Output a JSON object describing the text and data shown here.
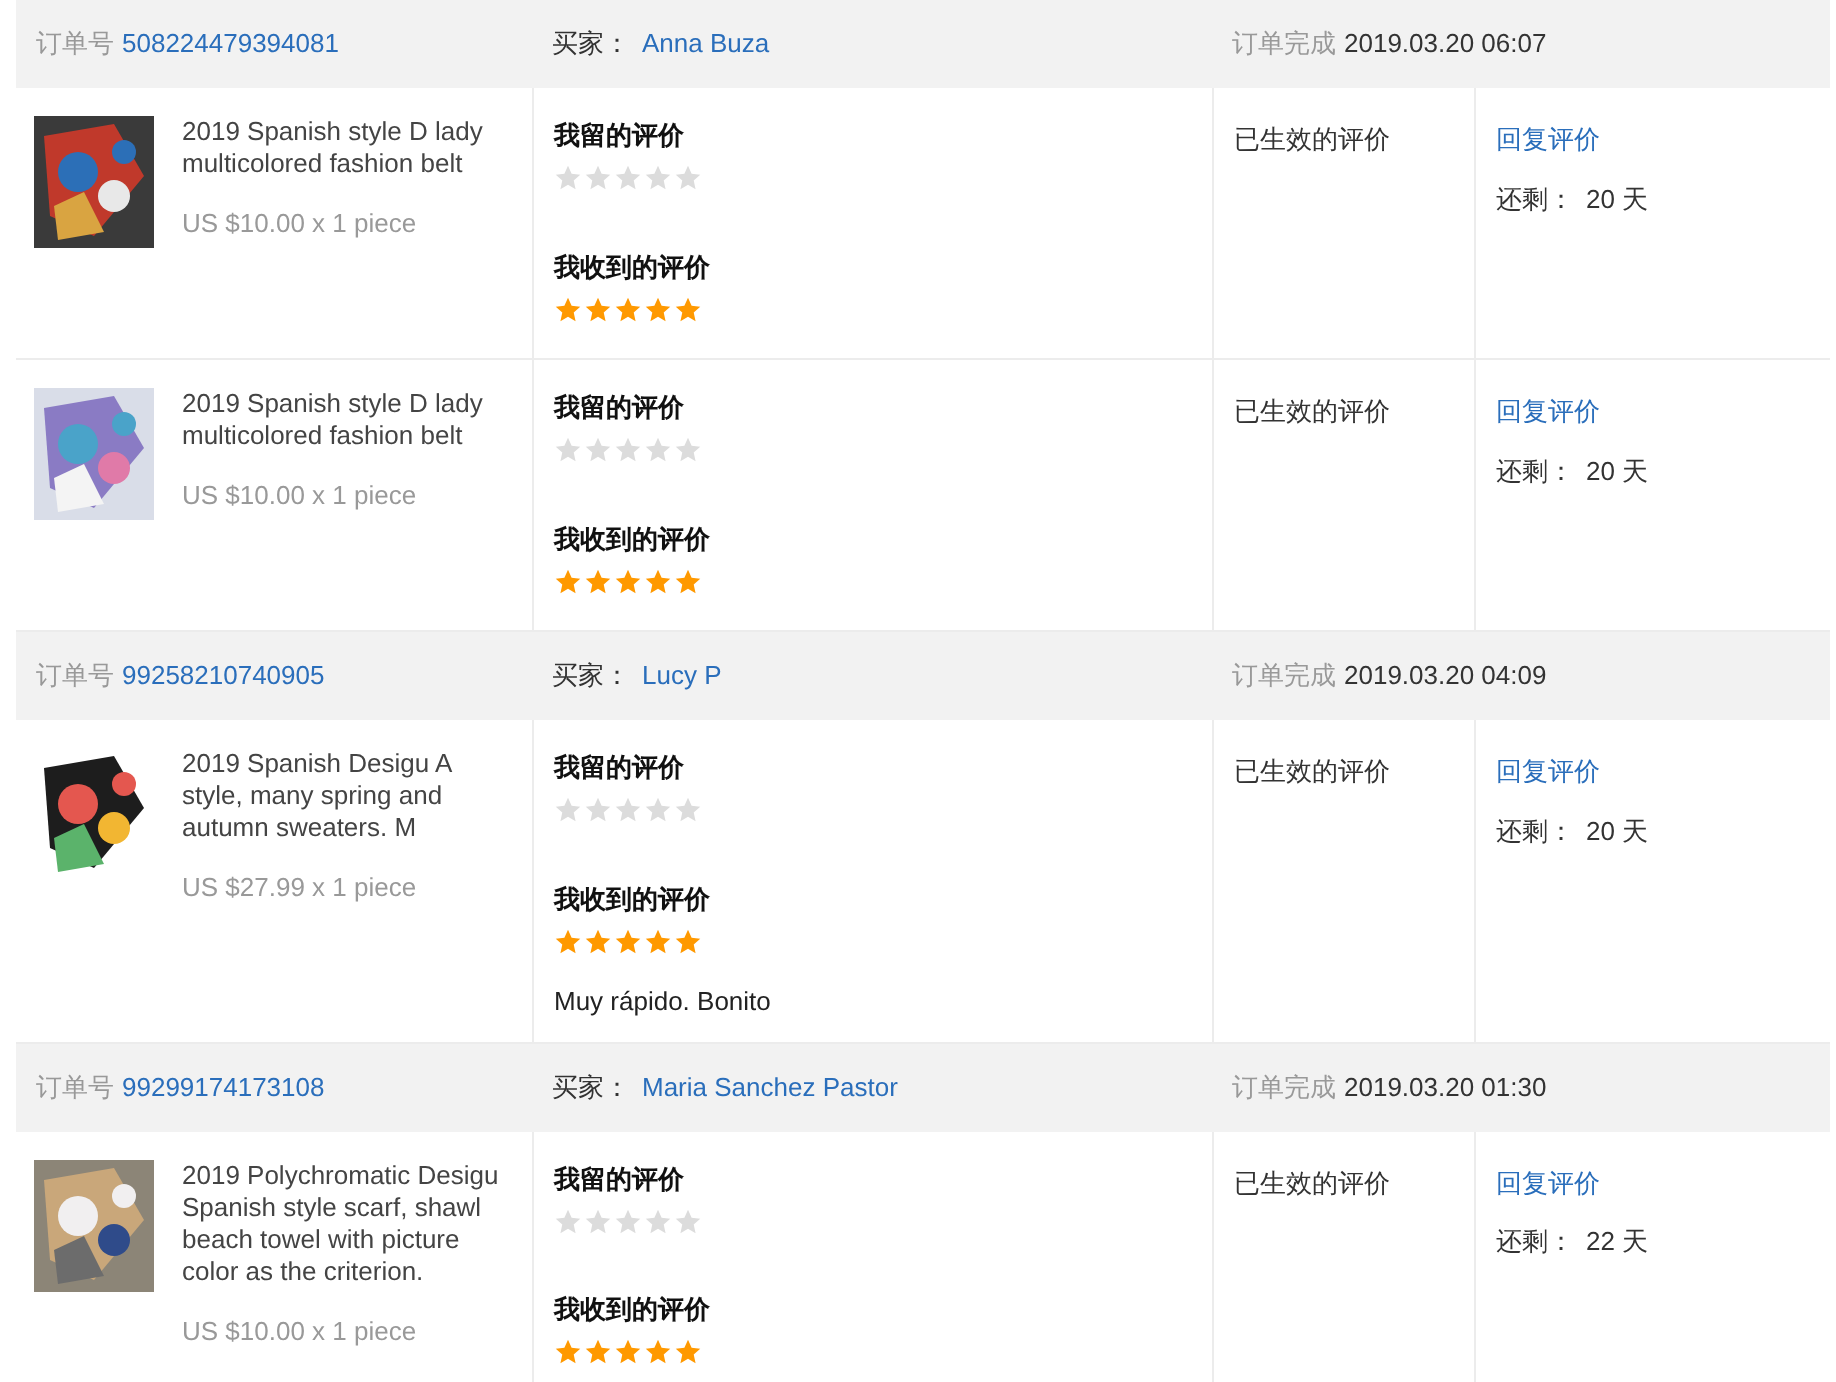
{
  "orders": [
    {
      "order_label": "订单号",
      "order_no": "508224479394081",
      "buyer_label": "买家：",
      "buyer": "Anna Buza",
      "completed_label": "订单完成",
      "completed_time": "2019.03.20 06:07",
      "items": [
        {
          "title": "2019 Spanish style D lady multicolored fashion belt",
          "price": "US $10.00 x 1 piece",
          "my_review_label": "我留的评价",
          "my_review": {
            "stars": 0
          },
          "received_label": "我收到的评价",
          "received": {
            "stars": 5
          },
          "status": "已生效的评价",
          "reply_link": "回复评价",
          "remaining_label": "还剩：",
          "remaining": "20 天"
        },
        {
          "title": "2019 Spanish style D lady multicolored fashion belt",
          "price": "US $10.00 x 1 piece",
          "my_review_label": "我留的评价",
          "my_review": {
            "stars": 0
          },
          "received_label": "我收到的评价",
          "received": {
            "stars": 5
          },
          "status": "已生效的评价",
          "reply_link": "回复评价",
          "remaining_label": "还剩：",
          "remaining": "20 天"
        }
      ]
    },
    {
      "order_label": "订单号",
      "order_no": "99258210740905",
      "buyer_label": "买家：",
      "buyer": "Lucy P",
      "completed_label": "订单完成",
      "completed_time": "2019.03.20 04:09",
      "items": [
        {
          "title": "2019 Spanish Desigu A style, many spring and autumn sweaters. M",
          "price": "US $27.99 x 1 piece",
          "my_review_label": "我留的评价",
          "my_review": {
            "stars": 0
          },
          "received_label": "我收到的评价",
          "received": {
            "stars": 5
          },
          "comment": "Muy rápido. Bonito",
          "status": "已生效的评价",
          "reply_link": "回复评价",
          "remaining_label": "还剩：",
          "remaining": "20 天"
        }
      ]
    },
    {
      "order_label": "订单号",
      "order_no": "99299174173108",
      "buyer_label": "买家：",
      "buyer": "Maria Sanchez Pastor",
      "completed_label": "订单完成",
      "completed_time": "2019.03.20 01:30",
      "items": [
        {
          "title": "2019 Polychromatic Desigu Spanish style scarf, shawl beach towel with picture color as the criterion.",
          "price": "US $10.00 x 1 piece",
          "my_review_label": "我留的评价",
          "my_review": {
            "stars": 0
          },
          "received_label": "我收到的评价",
          "received": {
            "stars": 5
          },
          "status": "已生效的评价",
          "reply_link": "回复评价",
          "remaining_label": "还剩：",
          "remaining": "22 天"
        }
      ]
    }
  ]
}
